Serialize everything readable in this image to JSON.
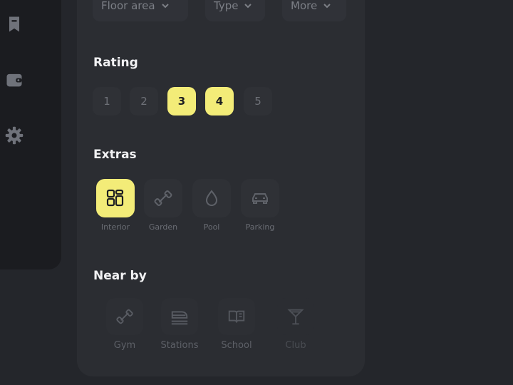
{
  "filters": {
    "floor_area": "Floor area",
    "type": "Type",
    "more": "More"
  },
  "rating": {
    "title": "Rating",
    "options": [
      "1",
      "2",
      "3",
      "4",
      "5"
    ],
    "selected": [
      "3",
      "4"
    ]
  },
  "extras": {
    "title": "Extras",
    "items": [
      {
        "label": "Interior",
        "icon": "interior-icon",
        "selected": true
      },
      {
        "label": "Garden",
        "icon": "dumbbell-icon",
        "selected": false
      },
      {
        "label": "Pool",
        "icon": "water-drop-icon",
        "selected": false
      },
      {
        "label": "Parking",
        "icon": "car-icon",
        "selected": false
      }
    ]
  },
  "nearby": {
    "title": "Near by",
    "items": [
      {
        "label": "Gym",
        "icon": "dumbbell-icon"
      },
      {
        "label": "Stations",
        "icon": "train-icon"
      },
      {
        "label": "School",
        "icon": "book-icon"
      },
      {
        "label": "Club",
        "icon": "cocktail-icon"
      }
    ]
  },
  "sidebar": {
    "icons": [
      "bookmark-icon",
      "wallet-icon",
      "gear-icon"
    ]
  },
  "colors": {
    "accent": "#f3ec78",
    "panel": "#2b2d32",
    "background": "#24262b",
    "sidebar": "#1b1c20"
  }
}
